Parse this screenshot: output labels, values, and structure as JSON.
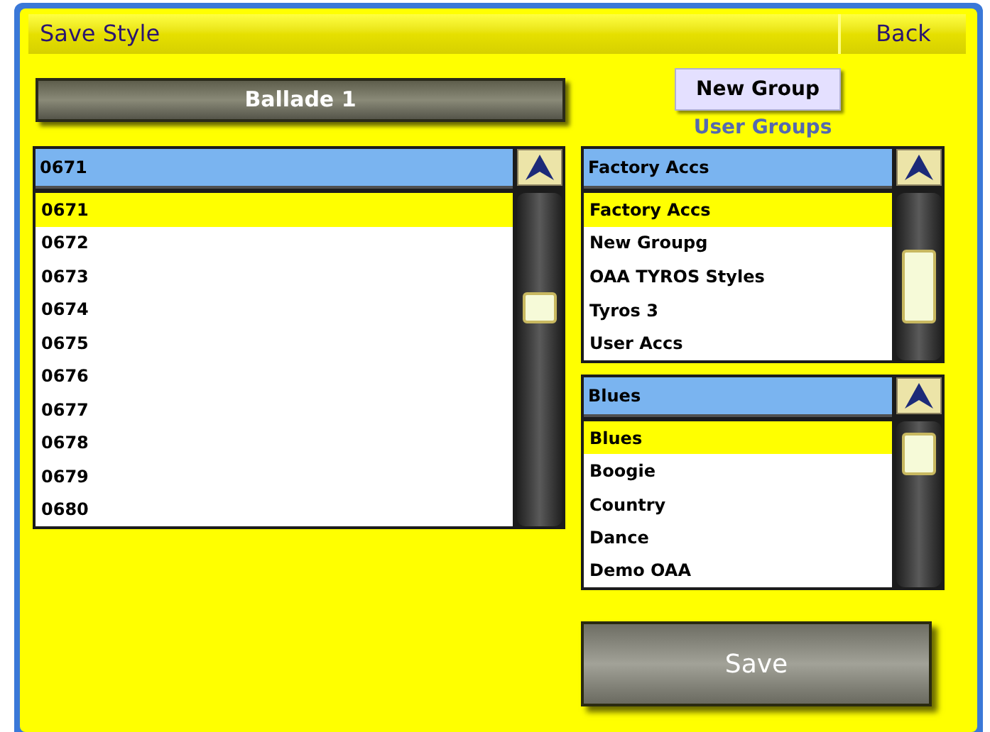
{
  "title": "Save Style",
  "back_button": "Back",
  "name_button": "Ballade 1",
  "new_group_button": "New Group",
  "user_groups_label": "User Groups",
  "style_list": {
    "value": "0671",
    "items": [
      {
        "label": "0671",
        "selected": true
      },
      {
        "label": "0672",
        "selected": false
      },
      {
        "label": "0673",
        "selected": false
      },
      {
        "label": "0674",
        "selected": false
      },
      {
        "label": "0675",
        "selected": false
      },
      {
        "label": "0676",
        "selected": false
      },
      {
        "label": "0677",
        "selected": false
      },
      {
        "label": "0678",
        "selected": false
      },
      {
        "label": "0679",
        "selected": false
      },
      {
        "label": "0680",
        "selected": false
      }
    ]
  },
  "user_groups_list": {
    "value": "Factory Accs",
    "items": [
      {
        "label": "Factory Accs",
        "selected": true
      },
      {
        "label": "New Groupg",
        "selected": false
      },
      {
        "label": "OAA TYROS Styles",
        "selected": false
      },
      {
        "label": "Tyros 3",
        "selected": false
      },
      {
        "label": "User Accs",
        "selected": false
      }
    ]
  },
  "groups_list": {
    "value": "Blues",
    "items": [
      {
        "label": "Blues",
        "selected": true
      },
      {
        "label": "Boogie",
        "selected": false
      },
      {
        "label": "Country",
        "selected": false
      },
      {
        "label": "Dance",
        "selected": false
      },
      {
        "label": "Demo OAA",
        "selected": false
      }
    ]
  },
  "save_button": "Save"
}
